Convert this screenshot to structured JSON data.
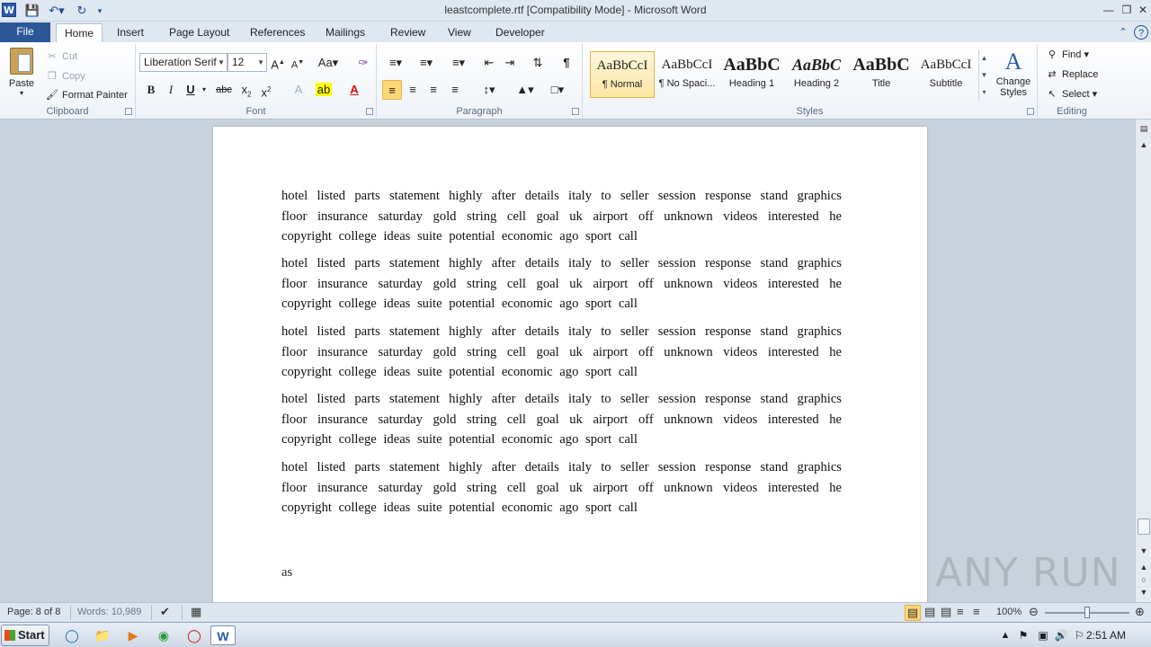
{
  "titlebar": {
    "title": "leastcomplete.rtf [Compatibility Mode]  -  Microsoft Word",
    "app_icon": "W"
  },
  "tabs": [
    "File",
    "Home",
    "Insert",
    "Page Layout",
    "References",
    "Mailings",
    "Review",
    "View",
    "Developer"
  ],
  "clipboard": {
    "paste": "Paste",
    "cut": "Cut",
    "copy": "Copy",
    "format_painter": "Format Painter",
    "label": "Clipboard"
  },
  "font": {
    "name": "Liberation Serif",
    "size": "12",
    "label": "Font"
  },
  "paragraph": {
    "label": "Paragraph"
  },
  "styles": {
    "label": "Styles",
    "items": [
      {
        "sample": "AaBbCcI",
        "name": "¶ Normal"
      },
      {
        "sample": "AaBbCcI",
        "name": "¶ No Spaci..."
      },
      {
        "sample": "AaBbC",
        "name": "Heading 1"
      },
      {
        "sample": "AaBbC",
        "name": "Heading 2"
      },
      {
        "sample": "AaBbC",
        "name": "Title"
      },
      {
        "sample": "AaBbCcI",
        "name": "Subtitle"
      }
    ],
    "change_styles": "Change Styles"
  },
  "editing": {
    "label": "Editing",
    "find": "Find",
    "replace": "Replace",
    "select": "Select"
  },
  "document": {
    "paragraphs": [
      "hotel listed   parts   statement  highly  after     details   italy    to   seller      session response stand graphics  floor  insurance  saturday gold string    cell goal uk airport off unknown  videos    interested he    copyright    college ideas   suite   potential   economic  ago   sport     call",
      "hotel listed   parts   statement  highly  after     details   italy    to   seller      session response stand graphics  floor  insurance  saturday gold string    cell goal uk airport off unknown  videos    interested he    copyright    college ideas   suite   potential   economic  ago   sport     call",
      "hotel listed   parts   statement  highly  after     details   italy    to   seller      session response stand graphics  floor  insurance  saturday gold string    cell goal uk airport off unknown  videos    interested he    copyright    college ideas   suite   potential   economic  ago   sport     call",
      "hotel listed   parts   statement  highly  after     details   italy    to   seller      session response stand graphics  floor  insurance  saturday gold string    cell goal uk airport off unknown  videos    interested he    copyright    college ideas   suite   potential   economic  ago   sport     call",
      "hotel listed   parts   statement  highly  after     details   italy    to   seller      session response stand graphics  floor  insurance  saturday gold string    cell goal uk airport off unknown  videos    interested he    copyright    college ideas   suite   potential   economic  ago   sport     call"
    ],
    "last_text": "as"
  },
  "watermark": "ANY RUN",
  "statusbar": {
    "page": "Page: 8 of 8",
    "words": "Words: 10,989",
    "zoom": "100%"
  },
  "taskbar": {
    "start": "Start",
    "clock": "2:51 AM"
  }
}
